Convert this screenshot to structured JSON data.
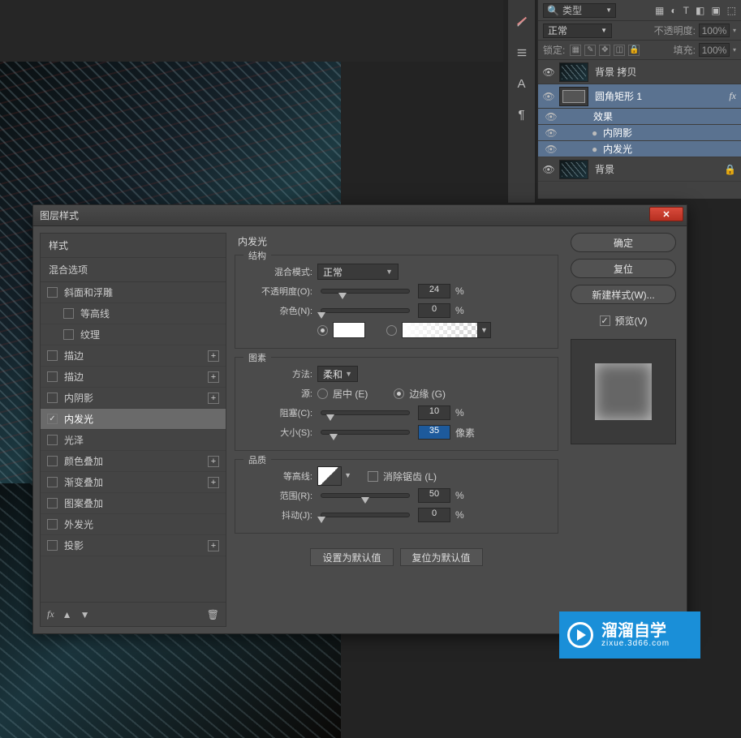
{
  "canvas_top_bg": "#262626",
  "layers_panel": {
    "search_icon": "search-icon",
    "type_label": "类型",
    "header_icons": [
      "image-filter-icon",
      "circle-half-icon",
      "text-icon",
      "shape-icon",
      "smartobj-icon",
      "artboard-icon"
    ],
    "blend_mode": "正常",
    "opacity_label": "不透明度:",
    "opacity_value": "100%",
    "lock_label": "锁定:",
    "fill_label": "填充:",
    "fill_value": "100%",
    "layers": [
      {
        "vis": true,
        "thumb": "pine",
        "name": "背景 拷贝",
        "selected": false
      },
      {
        "vis": true,
        "thumb": "shape",
        "name": "圆角矩形 1",
        "selected": true,
        "fx": "fx"
      },
      {
        "sub": true,
        "vis": true,
        "name": "效果"
      },
      {
        "sub": true,
        "vis": true,
        "dot": true,
        "name": "内阴影"
      },
      {
        "sub": true,
        "vis": true,
        "dot": true,
        "name": "内发光"
      },
      {
        "vis": true,
        "thumb": "pine",
        "name": "背景",
        "selected": false,
        "lock": true
      }
    ]
  },
  "dialog": {
    "title": "图层样式",
    "ok": "确定",
    "reset": "复位",
    "new_style": "新建样式(W)...",
    "preview": "预览(V)",
    "styles_header": "样式",
    "blending_options": "混合选项",
    "style_list": [
      {
        "label": "斜面和浮雕",
        "checked": false,
        "plus": false
      },
      {
        "label": "等高线",
        "checked": false,
        "indent": true
      },
      {
        "label": "纹理",
        "checked": false,
        "indent": true
      },
      {
        "label": "描边",
        "checked": false,
        "plus": true
      },
      {
        "label": "描边",
        "checked": false,
        "plus": true
      },
      {
        "label": "内阴影",
        "checked": false,
        "plus": true
      },
      {
        "label": "内发光",
        "checked": true,
        "selected": true
      },
      {
        "label": "光泽",
        "checked": false
      },
      {
        "label": "颜色叠加",
        "checked": false,
        "plus": true
      },
      {
        "label": "渐变叠加",
        "checked": false,
        "plus": true
      },
      {
        "label": "图案叠加",
        "checked": false
      },
      {
        "label": "外发光",
        "checked": false
      },
      {
        "label": "投影",
        "checked": false,
        "plus": true
      }
    ],
    "fx_label": "fx",
    "section_title": "内发光",
    "structure": {
      "legend": "结构",
      "blend_mode_label": "混合模式:",
      "blend_mode_value": "正常",
      "opacity_label": "不透明度(O):",
      "opacity_value": "24",
      "noise_label": "杂色(N):",
      "noise_value": "0",
      "pct": "%",
      "color_white": "#ffffff"
    },
    "elements": {
      "legend": "图素",
      "technique_label": "方法:",
      "technique_value": "柔和",
      "source_label": "源:",
      "source_center": "居中 (E)",
      "source_edge": "边缘 (G)",
      "choke_label": "阻塞(C):",
      "choke_value": "10",
      "size_label": "大小(S):",
      "size_value": "35",
      "px": "像素",
      "pct": "%"
    },
    "quality": {
      "legend": "品质",
      "contour_label": "等高线:",
      "antialias_label": "消除锯齿 (L)",
      "range_label": "范围(R):",
      "range_value": "50",
      "jitter_label": "抖动(J):",
      "jitter_value": "0",
      "pct": "%"
    },
    "make_default": "设置为默认值",
    "reset_default": "复位为默认值"
  },
  "watermark": {
    "main": "溜溜自学",
    "sub": "zixue.3d66.com"
  }
}
